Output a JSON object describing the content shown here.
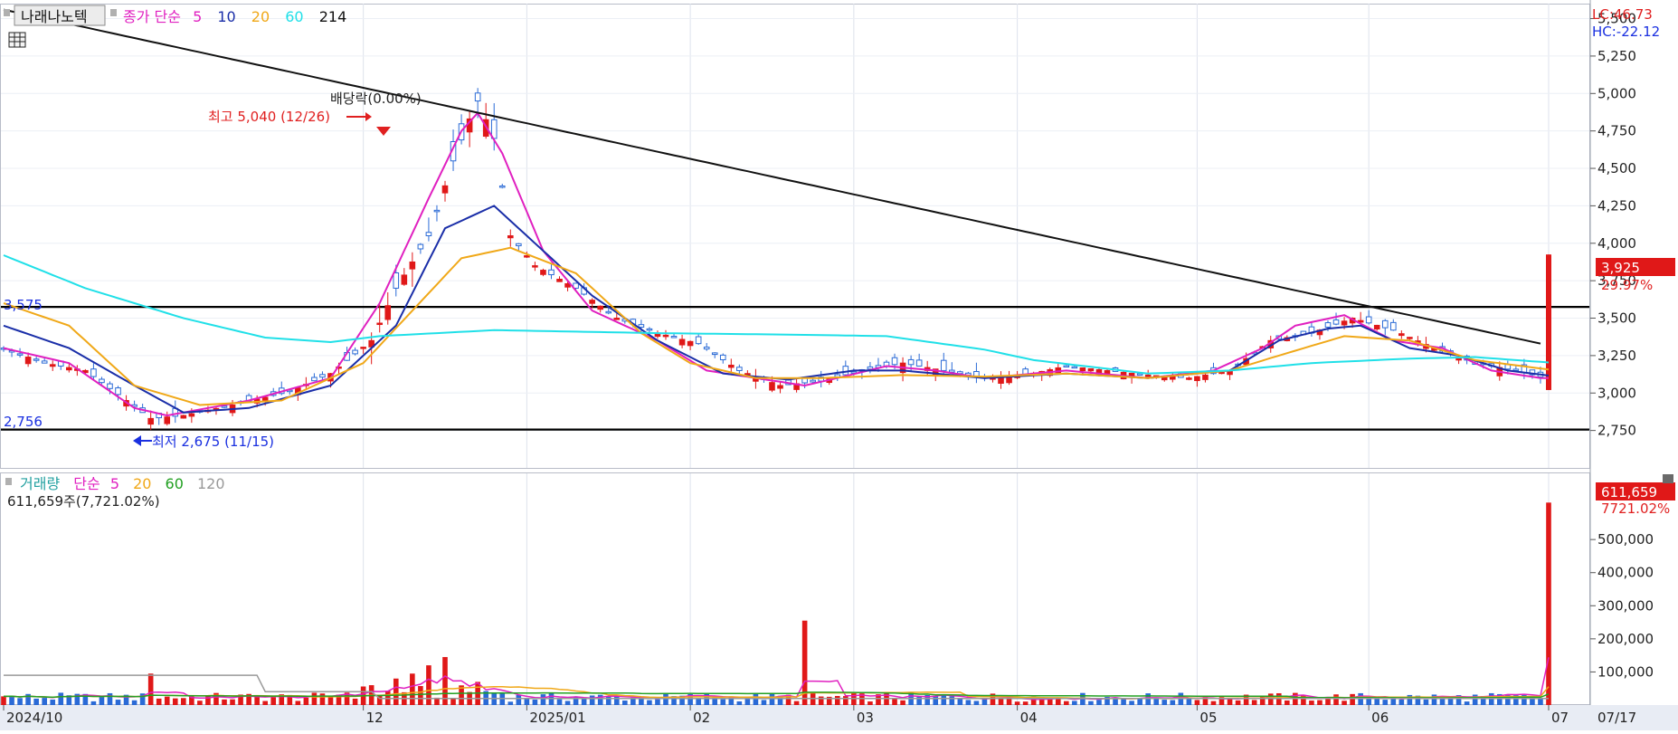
{
  "stock_name": "나래나노텍",
  "price_legend": {
    "type_label": "종가 단순",
    "periods": [
      "5",
      "10",
      "20",
      "60",
      "214"
    ],
    "colors": [
      "#e020c0",
      "#1a2ea8",
      "#f0a818",
      "#20e0e8",
      "#111111"
    ]
  },
  "volume_legend": {
    "title": "거래량",
    "type_label": "단순",
    "periods": [
      "5",
      "20",
      "60",
      "120"
    ],
    "colors": [
      "#e020c0",
      "#f0a818",
      "#22a022",
      "#999999"
    ],
    "info": "611,659주(7,721.02%)"
  },
  "status": {
    "lc": "LC:46.73",
    "hc": "HC:-22.12"
  },
  "annotations": {
    "dividend": "배당락(0.00%)",
    "high": "최고 5,040 (12/26)",
    "low": "최저 2,675 (11/15)",
    "level_upper": "3,575",
    "level_lower": "2,756"
  },
  "current": {
    "price": "3,925",
    "change": "29.97%",
    "volume": "611,659",
    "volume_change": "7721.02%"
  },
  "date_label": "07/17",
  "chart_data": [
    {
      "type": "candlestick",
      "ylim": [
        2500,
        5600
      ],
      "y_ticks": [
        "5,500",
        "5,250",
        "5,000",
        "4,750",
        "4,500",
        "4,250",
        "4,000",
        "3,750",
        "3,500",
        "3,250",
        "3,000",
        "2,750"
      ],
      "x_labels": [
        "2024/10",
        "12",
        "2025/01",
        "02",
        "03",
        "04",
        "05",
        "06",
        "07"
      ],
      "horizontal_levels": [
        3575,
        2756
      ],
      "trend_start": 5560,
      "trend_end": 3330,
      "bars": 190,
      "close_anchors": [
        [
          0,
          3300
        ],
        [
          5,
          3200
        ],
        [
          10,
          3150
        ],
        [
          15,
          2950
        ],
        [
          18,
          2830
        ],
        [
          22,
          2850
        ],
        [
          28,
          2920
        ],
        [
          35,
          3010
        ],
        [
          40,
          3130
        ],
        [
          45,
          3350
        ],
        [
          48,
          3700
        ],
        [
          52,
          4050
        ],
        [
          55,
          4550
        ],
        [
          57,
          4830
        ],
        [
          58,
          4950
        ],
        [
          60,
          4700
        ],
        [
          62,
          4050
        ],
        [
          65,
          3850
        ],
        [
          70,
          3700
        ],
        [
          75,
          3500
        ],
        [
          80,
          3400
        ],
        [
          85,
          3330
        ],
        [
          90,
          3150
        ],
        [
          95,
          3050
        ],
        [
          100,
          3080
        ],
        [
          105,
          3150
        ],
        [
          110,
          3200
        ],
        [
          115,
          3150
        ],
        [
          120,
          3100
        ],
        [
          125,
          3120
        ],
        [
          130,
          3180
        ],
        [
          135,
          3150
        ],
        [
          140,
          3120
        ],
        [
          145,
          3100
        ],
        [
          150,
          3150
        ],
        [
          155,
          3350
        ],
        [
          160,
          3400
        ],
        [
          165,
          3500
        ],
        [
          170,
          3420
        ],
        [
          175,
          3300
        ],
        [
          180,
          3200
        ],
        [
          185,
          3150
        ],
        [
          190,
          3080
        ]
      ],
      "series": [
        {
          "name": "5",
          "color": "#e020c0",
          "anchors": [
            [
              0,
              3300
            ],
            [
              8,
              3200
            ],
            [
              16,
              2900
            ],
            [
              20,
              2850
            ],
            [
              30,
              2950
            ],
            [
              40,
              3100
            ],
            [
              46,
              3600
            ],
            [
              52,
              4300
            ],
            [
              56,
              4750
            ],
            [
              58,
              4870
            ],
            [
              61,
              4600
            ],
            [
              66,
              3950
            ],
            [
              72,
              3550
            ],
            [
              80,
              3350
            ],
            [
              86,
              3150
            ],
            [
              92,
              3100
            ],
            [
              98,
              3050
            ],
            [
              102,
              3100
            ],
            [
              108,
              3180
            ],
            [
              114,
              3150
            ],
            [
              120,
              3100
            ],
            [
              130,
              3150
            ],
            [
              140,
              3100
            ],
            [
              148,
              3150
            ],
            [
              154,
              3300
            ],
            [
              158,
              3450
            ],
            [
              164,
              3520
            ],
            [
              170,
              3350
            ],
            [
              176,
              3300
            ],
            [
              182,
              3150
            ],
            [
              188,
              3100
            ],
            [
              190,
              3100
            ]
          ]
        },
        {
          "name": "10",
          "color": "#1a2ea8",
          "anchors": [
            [
              0,
              3450
            ],
            [
              8,
              3300
            ],
            [
              16,
              3050
            ],
            [
              22,
              2870
            ],
            [
              30,
              2900
            ],
            [
              40,
              3050
            ],
            [
              48,
              3450
            ],
            [
              54,
              4100
            ],
            [
              60,
              4250
            ],
            [
              66,
              3950
            ],
            [
              72,
              3650
            ],
            [
              80,
              3350
            ],
            [
              88,
              3130
            ],
            [
              96,
              3090
            ],
            [
              104,
              3150
            ],
            [
              110,
              3150
            ],
            [
              120,
              3100
            ],
            [
              130,
              3130
            ],
            [
              140,
              3100
            ],
            [
              150,
              3150
            ],
            [
              156,
              3350
            ],
            [
              162,
              3430
            ],
            [
              166,
              3450
            ],
            [
              172,
              3300
            ],
            [
              178,
              3250
            ],
            [
              184,
              3150
            ],
            [
              190,
              3110
            ]
          ]
        },
        {
          "name": "20",
          "color": "#f0a818",
          "anchors": [
            [
              0,
              3600
            ],
            [
              8,
              3450
            ],
            [
              16,
              3050
            ],
            [
              24,
              2920
            ],
            [
              34,
              2950
            ],
            [
              44,
              3200
            ],
            [
              50,
              3550
            ],
            [
              56,
              3900
            ],
            [
              62,
              3970
            ],
            [
              70,
              3800
            ],
            [
              78,
              3400
            ],
            [
              84,
              3200
            ],
            [
              92,
              3100
            ],
            [
              100,
              3100
            ],
            [
              110,
              3120
            ],
            [
              120,
              3110
            ],
            [
              130,
              3130
            ],
            [
              140,
              3100
            ],
            [
              150,
              3150
            ],
            [
              156,
              3250
            ],
            [
              164,
              3380
            ],
            [
              172,
              3350
            ],
            [
              180,
              3220
            ],
            [
              190,
              3150
            ]
          ]
        },
        {
          "name": "60",
          "color": "#20e0e8",
          "anchors": [
            [
              0,
              3920
            ],
            [
              10,
              3700
            ],
            [
              22,
              3500
            ],
            [
              32,
              3370
            ],
            [
              40,
              3340
            ],
            [
              46,
              3380
            ],
            [
              60,
              3420
            ],
            [
              80,
              3400
            ],
            [
              96,
              3390
            ],
            [
              108,
              3380
            ],
            [
              120,
              3290
            ],
            [
              126,
              3220
            ],
            [
              140,
              3130
            ],
            [
              150,
              3150
            ],
            [
              160,
              3200
            ],
            [
              172,
              3230
            ],
            [
              180,
              3240
            ],
            [
              190,
              3200
            ]
          ]
        },
        {
          "name": "214",
          "color": "#111111"
        }
      ]
    },
    {
      "type": "bar",
      "ylim": [
        0,
        700000
      ],
      "y_ticks": [
        "500,000",
        "400,000",
        "300,000",
        "200,000",
        "100,000"
      ],
      "bars": 190,
      "base_volume": 25000,
      "spikes": [
        [
          18,
          95000
        ],
        [
          45,
          60000
        ],
        [
          48,
          80000
        ],
        [
          50,
          95000
        ],
        [
          52,
          120000
        ],
        [
          54,
          145000
        ],
        [
          58,
          70000
        ],
        [
          98,
          255000
        ],
        [
          189,
          611659
        ]
      ],
      "series": [
        {
          "name": "5",
          "color": "#e020c0"
        },
        {
          "name": "20",
          "color": "#f0a818"
        },
        {
          "name": "60",
          "color": "#22a022"
        },
        {
          "name": "120",
          "color": "#999999",
          "level": 90000
        }
      ]
    }
  ]
}
